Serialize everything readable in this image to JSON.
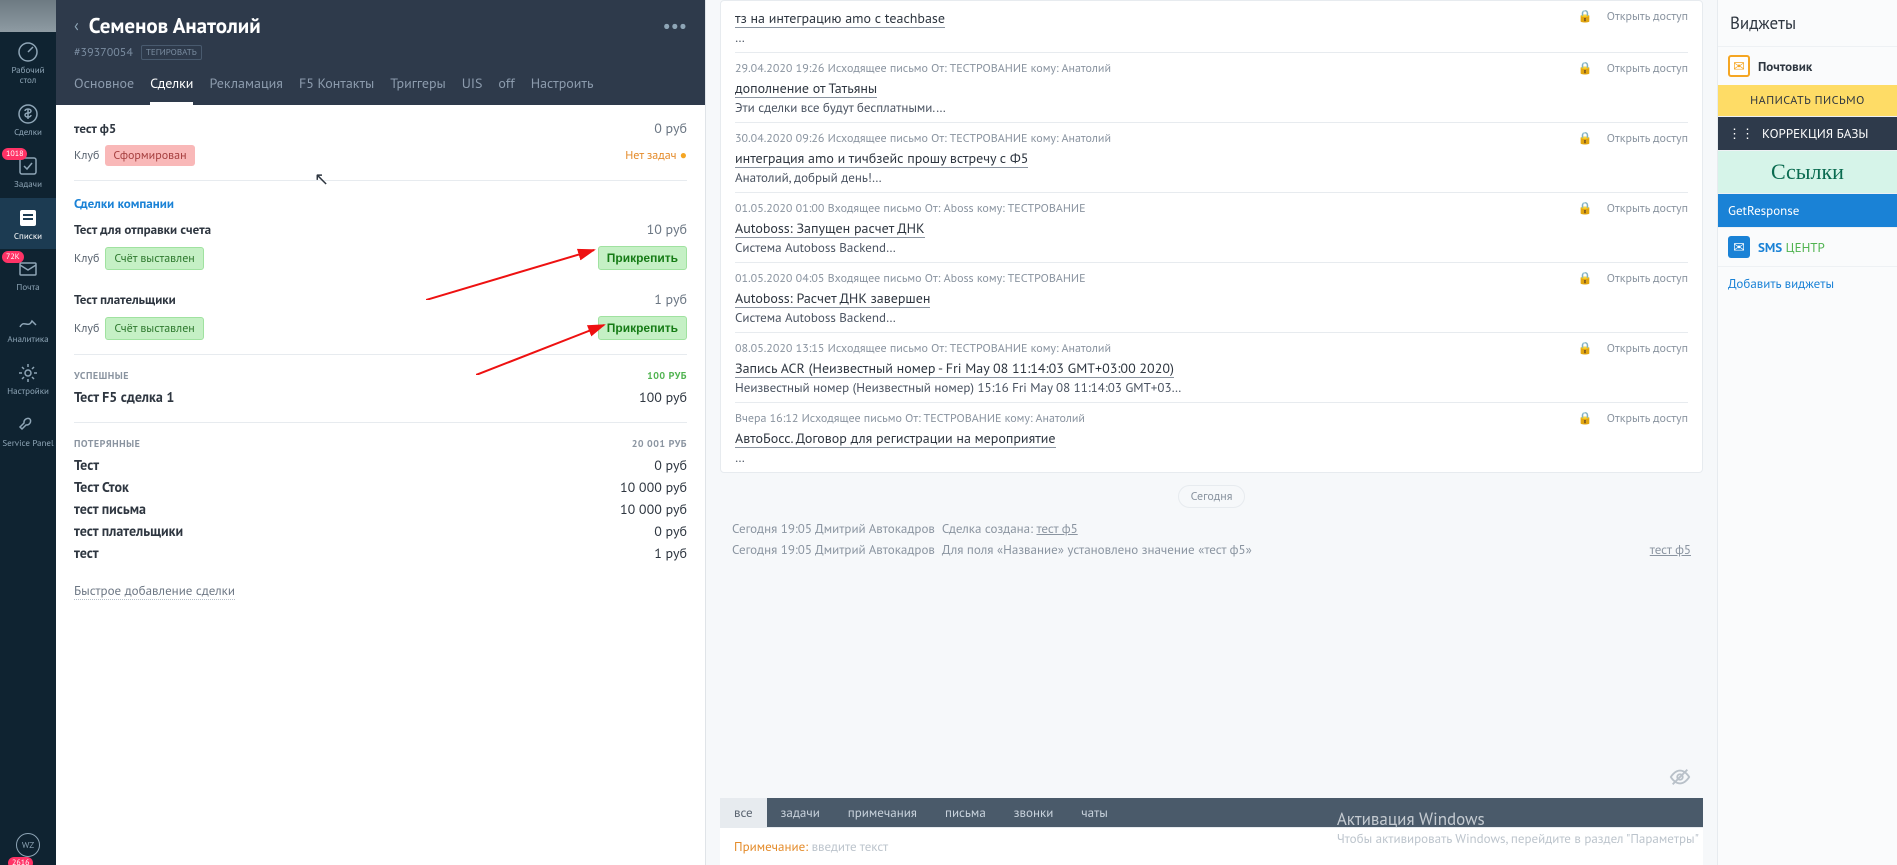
{
  "sidebar": {
    "items": [
      {
        "label": "Рабочий\nстол"
      },
      {
        "label": "Сделки"
      },
      {
        "label": "Задачи",
        "badge": "1018"
      },
      {
        "label": "Списки"
      },
      {
        "label": "Почта",
        "badge": "72К"
      },
      {
        "label": "Аналитика"
      },
      {
        "label": "Настройки"
      },
      {
        "label": "Service\nPanel"
      }
    ],
    "wz": "WZ",
    "wz_badge": "2616"
  },
  "lead": {
    "name": "Семенов Анатолий",
    "id": "#39370054",
    "tag_button": "ТЕГИРОВАТЬ",
    "tabs": [
      "Основное",
      "Сделки",
      "Рекламация",
      "F5 Контакты",
      "Триггеры",
      "UIS",
      "off",
      "Настроить"
    ],
    "active_tab": "Сделки",
    "main_deal": {
      "name": "тест ф5",
      "amount": "0 руб",
      "club": "Клуб",
      "status": "Сформирован",
      "no_tasks": "Нет задач"
    },
    "company_section": "Сделки компании",
    "company_deals": [
      {
        "name": "Тест для отправки счета",
        "amount": "10 руб",
        "club": "Клуб",
        "status": "Счёт выставлен",
        "attach": "Прикрепить"
      },
      {
        "name": "Тест плательщики",
        "amount": "1 руб",
        "club": "Клуб",
        "status": "Счёт выставлен",
        "attach": "Прикрепить"
      }
    ],
    "successful": {
      "label": "УСПЕШНЫЕ",
      "total": "100 руб",
      "deals": [
        {
          "name": "Тест F5 сделка 1",
          "amount": "100 руб"
        }
      ]
    },
    "lost": {
      "label": "ПОТЕРЯННЫЕ",
      "total": "20 001 руб",
      "deals": [
        {
          "name": "Тест",
          "amount": "0 руб"
        },
        {
          "name": "Тест Сток",
          "amount": "10 000 руб"
        },
        {
          "name": "тест письма",
          "amount": "10 000 руб"
        },
        {
          "name": "тест плательщики",
          "amount": "0 руб"
        },
        {
          "name": "тест",
          "amount": "1 руб"
        }
      ]
    },
    "add_deal": "Быстрое добавление сделки"
  },
  "feed": {
    "access": "Открыть доступ",
    "items": [
      {
        "meta": "",
        "subj": "тз на интеграцию amo с teachbase",
        "body": "…"
      },
      {
        "meta": "29.04.2020 19:26 Исходящее письмо От: ТЕСТРОВАНИЕ кому: Анатолий",
        "subj": "дополнение от Татьяны",
        "body": "Эти сделки все будут бесплатными.…"
      },
      {
        "meta": "30.04.2020 09:26 Исходящее письмо От: ТЕСТРОВАНИЕ кому: Анатолий",
        "subj": "интеграция amo и тичбзейс прошу встречу с Ф5",
        "body": "Анатолий, добрый день!…"
      },
      {
        "meta": "01.05.2020 01:00 Входящее письмо От: Aboss кому: ТЕСТРОВАНИЕ",
        "subj": "Autoboss: Запущен расчет ДНК",
        "body": "Система Autoboss Backend…"
      },
      {
        "meta": "01.05.2020 04:05 Входящее письмо От: Aboss кому: ТЕСТРОВАНИЕ",
        "subj": "Autoboss: Расчет ДНК завершен",
        "body": "Система Autoboss Backend…"
      },
      {
        "meta": "08.05.2020 13:15 Исходящее письмо От: ТЕСТРОВАНИЕ кому: Анатолий",
        "subj": "Запись ACR (Неизвестный номер - Fri May 08 11:14:03 GMT+03:00 2020)",
        "body": "Неизвестный номер (Неизвестный номер) 15:16 Fri May 08 11:14:03 GMT+03…"
      },
      {
        "meta": "Вчера 16:12 Исходящее письмо От: ТЕСТРОВАНИЕ кому: Анатолий",
        "subj": "АвтоБосс. Договор для регистрации на мероприятие",
        "body": "…"
      }
    ],
    "today": "Сегодня",
    "log": [
      {
        "t": "Сегодня 19:05 Дмитрий Автокадров",
        "a": "Сделка создана:",
        "l": "тест ф5",
        "r": ""
      },
      {
        "t": "Сегодня 19:05 Дмитрий Автокадров",
        "a": "Для поля «Название» установлено значение «тест ф5»",
        "l": "",
        "r": "тест ф5"
      }
    ],
    "note_tabs": [
      "все",
      "задачи",
      "примечания",
      "письма",
      "звонки",
      "чаты"
    ],
    "note_label": "Примечание:",
    "note_placeholder": "введите текст",
    "activation_title": "Активация Windows",
    "activation_sub": "Чтобы активировать Windows, перейдите в раздел \"Параметры\""
  },
  "widgets": {
    "title": "Виджеты",
    "mail": "Почтовик",
    "write": "НАПИСАТЬ ПИСЬМО",
    "correction": "КОРРЕКЦИЯ БАЗЫ",
    "links": "Ссылки",
    "gr": "GetResponse",
    "sms": "SMS ЦЕНТР",
    "add": "Добавить виджеты"
  }
}
